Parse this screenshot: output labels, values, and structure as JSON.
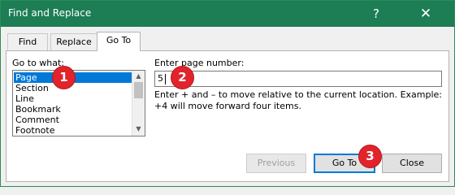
{
  "window": {
    "title": "Find and Replace",
    "help_glyph": "?",
    "close_glyph": "✕"
  },
  "tabs": [
    {
      "label": "Find"
    },
    {
      "label": "Replace"
    },
    {
      "label": "Go To"
    }
  ],
  "goto": {
    "what_label": "Go to what:",
    "items": [
      "Page",
      "Section",
      "Line",
      "Bookmark",
      "Comment",
      "Footnote"
    ],
    "selected": "Page",
    "number_label": "Enter page number:",
    "number_value": "5",
    "description": "Enter + and – to move relative to the current location. Example: +4 will move forward four items."
  },
  "buttons": {
    "previous": "Previous",
    "goto": "Go To",
    "close": "Close"
  },
  "annotations": [
    "1",
    "2",
    "3"
  ],
  "colors": {
    "titlebar": "#1d7d55",
    "selection": "#0078d7",
    "badge": "#e1242b"
  }
}
